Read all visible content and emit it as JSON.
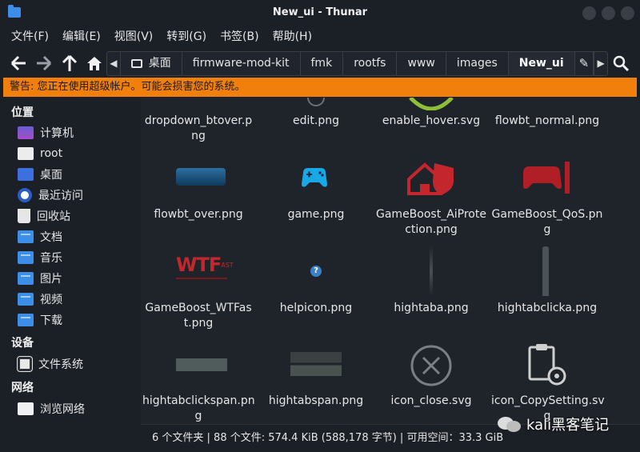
{
  "window": {
    "title": "New_ui - Thunar"
  },
  "menubar": [
    "文件(F)",
    "编辑(E)",
    "视图(V)",
    "转到(G)",
    "书签(B)",
    "帮助(H)"
  ],
  "pathbar": {
    "crumbs": [
      "桌面",
      "firmware-mod-kit",
      "fmk",
      "rootfs",
      "www",
      "images",
      "New_ui"
    ],
    "active": "New_ui"
  },
  "warning": "警告: 您正在使用超级帐户。可能会损害您的系统。",
  "sidebar": {
    "sections": [
      {
        "title": "位置",
        "items": [
          "计算机",
          "root",
          "桌面",
          "最近访问",
          "回收站",
          "文档",
          "音乐",
          "图片",
          "视频",
          "下载"
        ]
      },
      {
        "title": "设备",
        "items": [
          "文件系统"
        ]
      },
      {
        "title": "网络",
        "items": [
          "浏览网络"
        ]
      }
    ]
  },
  "files": [
    {
      "line1": "dropdown_btover.p",
      "line2": "ng"
    },
    {
      "line1": "edit.png",
      "line2": ""
    },
    {
      "line1": "enable_hover.svg",
      "line2": ""
    },
    {
      "line1": "flowbt_normal.png",
      "line2": ""
    },
    {
      "line1": "flowbt_over.png",
      "line2": ""
    },
    {
      "line1": "game.png",
      "line2": ""
    },
    {
      "line1": "GameBoost_AiProte",
      "line2": "ction.png"
    },
    {
      "line1": "GameBoost_QoS.pn",
      "line2": "g"
    },
    {
      "line1": "GameBoost_WTFas",
      "line2": "t.png"
    },
    {
      "line1": "helpicon.png",
      "line2": ""
    },
    {
      "line1": "hightaba.png",
      "line2": ""
    },
    {
      "line1": "hightabclicka.png",
      "line2": ""
    },
    {
      "line1": "hightabclickspan.pn",
      "line2": "g"
    },
    {
      "line1": "hightabspan.png",
      "line2": ""
    },
    {
      "line1": "icon_close.svg",
      "line2": ""
    },
    {
      "line1": "icon_CopySetting.sv",
      "line2": "g"
    }
  ],
  "thumb_text": {
    "wtfast": "WTF",
    "wtfast_sup": "AST",
    "help": "?"
  },
  "statusbar": "6 个文件夹 | 88 个文件: 574.4 KiB (588,178 字节) | 可用空间：33.3 GiB",
  "watermark": "kali黑客笔记",
  "colors": {
    "warning_bg": "#f07f0c",
    "folder": "#3d8ee8",
    "accent_red": "#c4262e"
  }
}
